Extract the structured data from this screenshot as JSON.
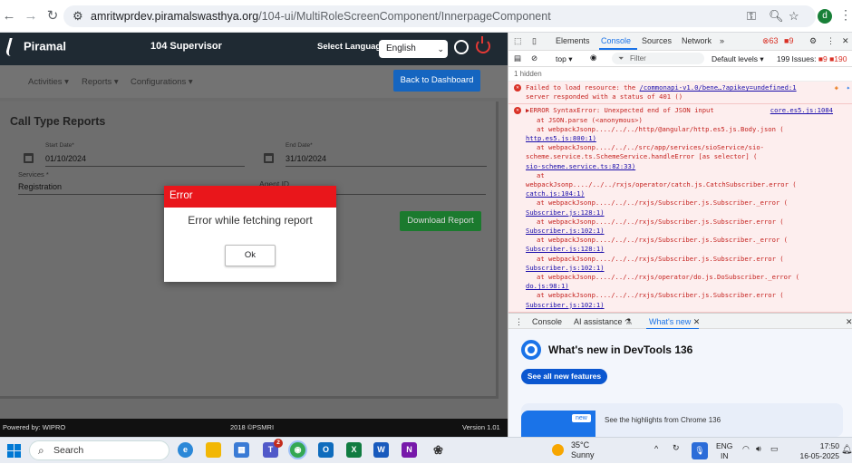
{
  "browser": {
    "url_host": "amritwprdev.piramalswasthya.org",
    "url_path": "/104-ui/MultiRoleScreenComponent/InnerpageComponent",
    "profile_initial": "d"
  },
  "app": {
    "logo_text": "Piramal",
    "title": "104 Supervisor",
    "language_label": "Select Language:",
    "language_value": "English",
    "nav": [
      "Activities",
      "Reports",
      "Configurations"
    ],
    "back_button": "Back to Dashboard",
    "form_title": "Call Type Reports",
    "start_date_label": "Start Date*",
    "start_date_value": "01/10/2024",
    "end_date_label": "End Date*",
    "end_date_value": "31/10/2024",
    "services_label": "Services *",
    "services_value": "Registration",
    "agent_label": "Agent ID",
    "download_button": "Download Report",
    "footer_left": "Powered by: WIPRO",
    "footer_center": "2018 ©PSMRI",
    "footer_right": "Version 1.01"
  },
  "modal": {
    "header": "Error",
    "message": "Error while fetching report",
    "ok": "Ok"
  },
  "devtools": {
    "tabs": [
      "Elements",
      "Console",
      "Sources",
      "Network"
    ],
    "error_count": "63",
    "warn_count": "9",
    "context": "top",
    "filter_placeholder": "Filter",
    "levels": "Default levels",
    "issues": "199 Issues:",
    "issue_err": "9",
    "issue_warn": "190",
    "hidden": "1 hidden",
    "log": {
      "e1_a": "Failed to load resource: the ",
      "e1_link": "/commonapi-v1.0/bene…?apikey=undefined:1",
      "e1_b": "server responded with a status of 401 ()",
      "e2_head": "▶ERROR SyntaxError: Unexpected end of JSON input",
      "e2_src": "core.es5.js:1084",
      "lines": [
        "at JSON.parse (<anonymous>)",
        "at webpackJsonp..../../../http/@angular/http.es5.js.Body.json (",
        "http.es5.js:800:1)",
        "at webpackJsonp..../../../src/app/services/sioService/sio-",
        "scheme.service.ts.SchemeService.handleError [as selector] (",
        "sio-scheme.service.ts:82:33)",
        "at",
        "webpackJsonp..../../../rxjs/operator/catch.js.CatchSubscriber.error (",
        "catch.js:104:1)",
        "at webpackJsonp..../../../rxjs/Subscriber.js.Subscriber._error (",
        "Subscriber.js:128:1)",
        "at webpackJsonp..../../../rxjs/Subscriber.js.Subscriber.error (",
        "Subscriber.js:102:1)",
        "at webpackJsonp..../../../rxjs/Subscriber.js.Subscriber._error (",
        "Subscriber.js:128:1)",
        "at webpackJsonp..../../../rxjs/Subscriber.js.Subscriber.error (",
        "Subscriber.js:102:1)",
        "at webpackJsonp..../../../rxjs/operator/do.js.DoSubscriber._error (",
        "do.js:98:1)",
        "at webpackJsonp..../../../rxjs/Subscriber.js.Subscriber.error (",
        "Subscriber.js:102:1)"
      ]
    },
    "drawer_tabs": [
      "Console",
      "AI assistance",
      "What's new"
    ],
    "whats_new_title": "What's new in DevTools 136",
    "see_all": "See all new features",
    "new_badge": "new",
    "highlights": "See the highlights from Chrome 136"
  },
  "taskbar": {
    "search_placeholder": "Search",
    "teams_badge": "2",
    "temp": "35°C",
    "condition": "Sunny",
    "lang1": "ENG",
    "lang2": "IN",
    "time": "17:50",
    "date": "16-05-2025"
  }
}
